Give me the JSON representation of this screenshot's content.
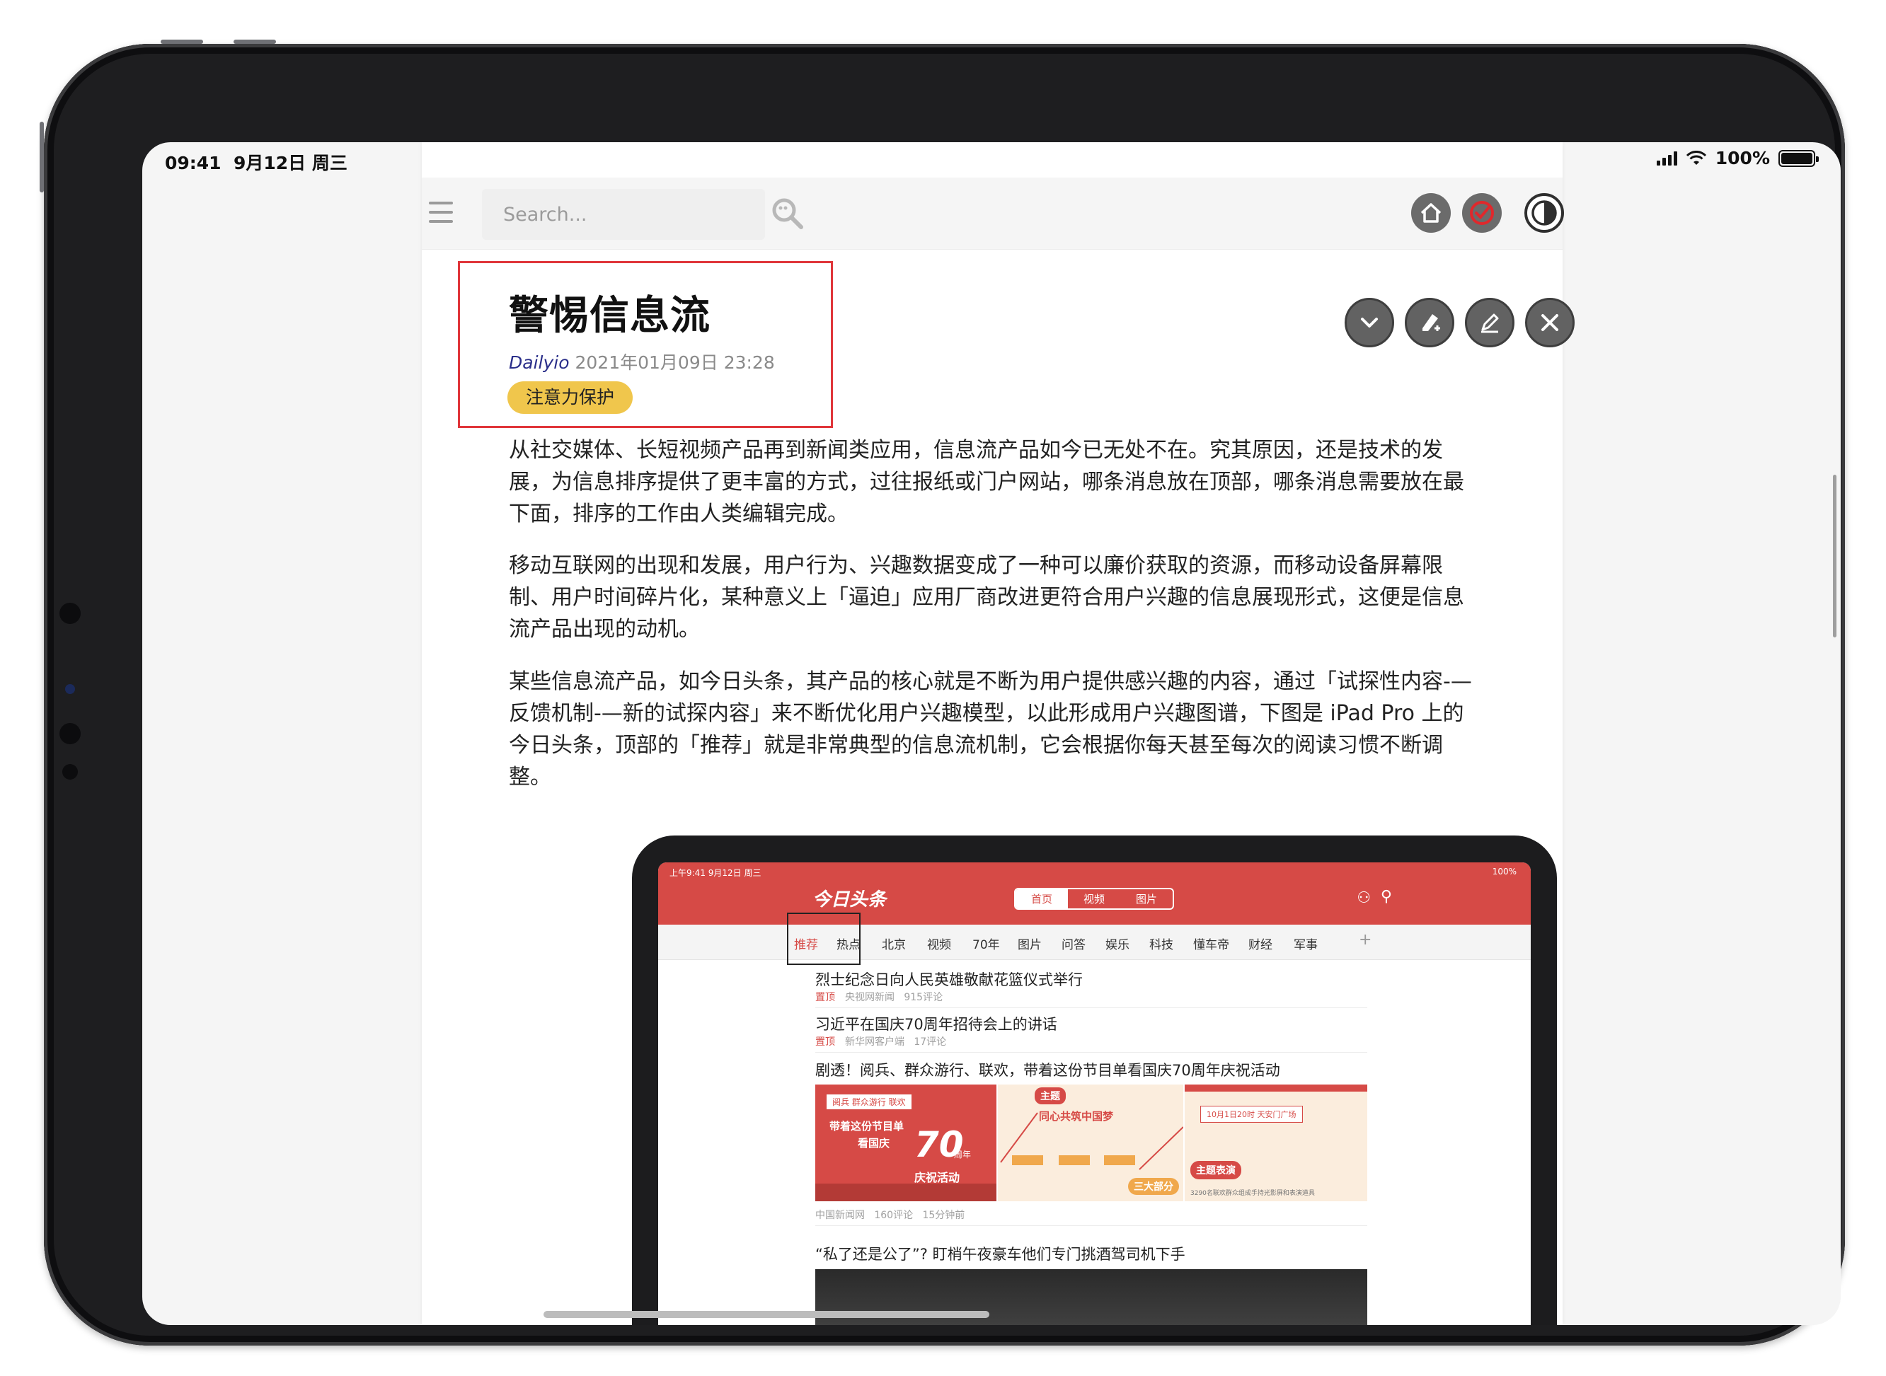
{
  "status_bar": {
    "time": "09:41",
    "date": "9月12日 周三",
    "battery": "100%",
    "battery_level": 1.0
  },
  "toolbar": {
    "search_placeholder": "Search...",
    "menu_icon": "hamburger-icon",
    "search_icon": "magnifier-icon",
    "buttons": [
      {
        "name": "home-button",
        "icon": "home-icon"
      },
      {
        "name": "check-button",
        "icon": "check-circle-icon",
        "color": "#e0282c"
      },
      {
        "name": "theme-toggle-button",
        "icon": "half-circle-icon"
      }
    ]
  },
  "article": {
    "title": "警惕信息流",
    "author": "Dailyio",
    "date": "2021年01月09日 23:28",
    "tag": "注意力保护",
    "tag_color": "#f0c64c",
    "highlight_color": "#e0363a",
    "actions": [
      {
        "name": "collapse-button",
        "icon": "chevron-down-icon"
      },
      {
        "name": "highlighter-button",
        "icon": "highlighter-icon"
      },
      {
        "name": "edit-button",
        "icon": "pencil-icon"
      },
      {
        "name": "close-button",
        "icon": "close-icon"
      }
    ],
    "paragraphs": [
      "从社交媒体、长短视频产品再到新闻类应用，信息流产品如今已无处不在。究其原因，还是技术的发展，为信息排序提供了更丰富的方式，过往报纸或门户网站，哪条消息放在顶部，哪条消息需要放在最下面，排序的工作由人类编辑完成。",
      "移动互联网的出现和发展，用户行为、兴趣数据变成了一种可以廉价获取的资源，而移动设备屏幕限制、用户时间碎片化，某种意义上「逼迫」应用厂商改进更符合用户兴趣的信息展现形式，这便是信息流产品出现的动机。",
      "某些信息流产品，如今日头条，其产品的核心就是不断为用户提供感兴趣的内容，通过「试探性内容-—反馈机制-—新的试探内容」来不断优化用户兴趣模型，以此形成用户兴趣图谱，下图是 iPad Pro 上的今日头条，顶部的「推荐」就是非常典型的信息流机制，它会根据你每天甚至每次的阅读习惯不断调整。"
    ]
  },
  "figure": {
    "status_time": "上午9:41  9月12日 周三",
    "status_battery": "100%",
    "app_name": "今日头条",
    "brand_color": "#d64a46",
    "segments": [
      "首页",
      "视频",
      "图片"
    ],
    "active_segment": 0,
    "nav": [
      "推荐",
      "热点",
      "北京",
      "视频",
      "70年",
      "图片",
      "问答",
      "娱乐",
      "科技",
      "懂车帝",
      "财经",
      "军事"
    ],
    "nav_plus": "+",
    "news": [
      {
        "title": "烈士纪念日向人民英雄敬献花篮仪式举行",
        "badge": "置顶",
        "source": "央视网新闻",
        "comments": "915评论"
      },
      {
        "title": "习近平在国庆70周年招待会上的讲话",
        "badge": "置顶",
        "source": "新华网客户端",
        "comments": "17评论"
      },
      {
        "title": "剧透！阅兵、群众游行、联欢，带着这份节目单看国庆70周年庆祝活动",
        "source": "中国新闻网",
        "comments": "160评论",
        "time": "15分钟前"
      },
      {
        "title": "“私了还是公了”? 盯梢午夜豪车他们专门挑酒驾司机下手"
      }
    ],
    "image_texts": {
      "img1_tag": "阅兵 群众游行 联欢",
      "img1_line1": "带着这份节目单",
      "img1_line2": "看国庆",
      "img1_number": "70",
      "img1_suffix": "周年",
      "img1_line3": "庆祝活动",
      "img2_badge": "主题",
      "img2_headline": "同心共筑中国梦",
      "img2_part": "三大部分",
      "img3_line": "10月1日20时  天安门广场",
      "img3_badge": "主题表演",
      "img3_caption": "3290名联欢群众组成手持光影屏和表演道具"
    }
  }
}
